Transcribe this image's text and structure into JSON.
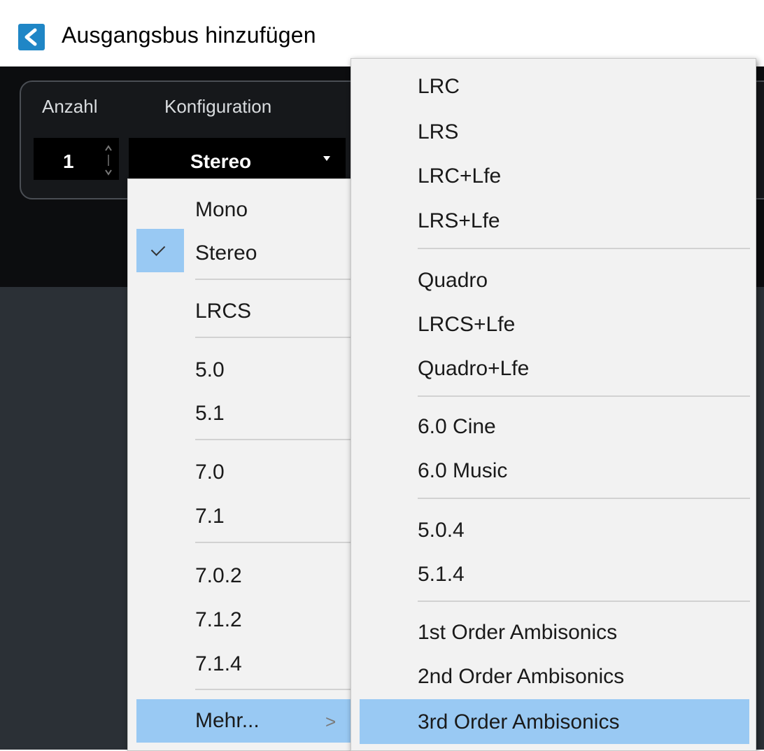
{
  "window": {
    "title": "Ausgangsbus hinzufügen",
    "icon": "cubase-back-icon",
    "accent": "#1f86c6"
  },
  "dialog": {
    "count_label": "Anzahl",
    "config_label": "Konfiguration",
    "count_value": "1",
    "config_value": "Stereo"
  },
  "menu_primary": {
    "items": [
      "Mono",
      "Stereo",
      "LRCS",
      "5.0",
      "5.1",
      "7.0",
      "7.1",
      "7.0.2",
      "7.1.2",
      "7.1.4",
      "Mehr..."
    ],
    "checked": "Stereo",
    "highlighted": "Mehr...",
    "submenu_arrow": ">"
  },
  "menu_more": {
    "items": [
      "LRC",
      "LRS",
      "LRC+Lfe",
      "LRS+Lfe",
      "Quadro",
      "LRCS+Lfe",
      "Quadro+Lfe",
      "6.0 Cine",
      "6.0 Music",
      "5.0.4",
      "5.1.4",
      "1st Order Ambisonics",
      "2nd Order Ambisonics",
      "3rd Order Ambisonics"
    ],
    "highlighted": "3rd Order Ambisonics"
  },
  "colors": {
    "highlight": "#99c9f3",
    "menu_bg": "#f2f2f2",
    "dialog_bg": "#0c0d0f"
  }
}
